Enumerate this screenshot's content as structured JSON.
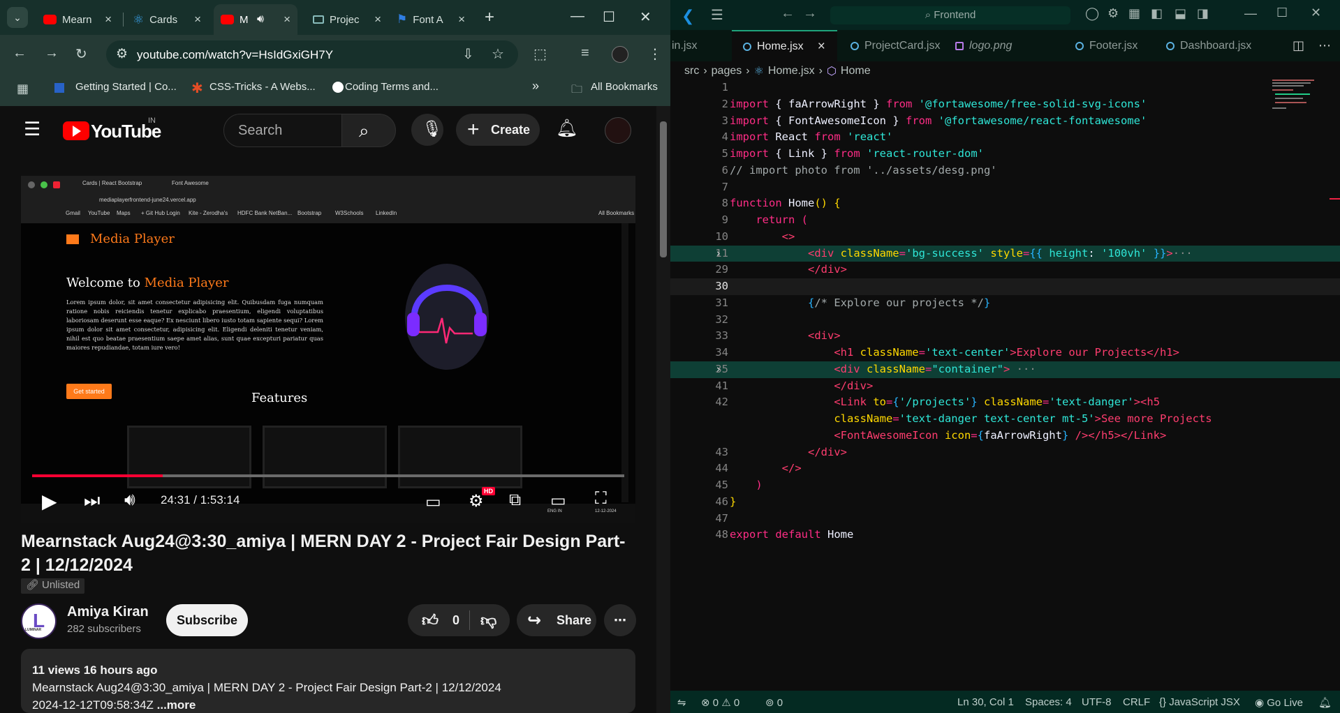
{
  "browser": {
    "tabs": [
      {
        "label": "Mearn",
        "icon": "youtube-icon"
      },
      {
        "label": "Cards",
        "icon": "react-bootstrap-icon"
      },
      {
        "label": "M",
        "icon": "youtube-icon"
      },
      {
        "label": "Projec",
        "icon": "vercel-icon"
      },
      {
        "label": "Font A",
        "icon": "flag-icon"
      }
    ],
    "new_tab": "+",
    "url": "youtube.com/watch?v=HsIdGxiGH7Y",
    "bookmarks": [
      "Getting Started | Co...",
      "CSS-Tricks - A Webs...",
      "Coding Terms and..."
    ],
    "all_bookmarks": "All Bookmarks",
    "more_bookmarks": "»"
  },
  "youtube": {
    "logo": "YouTube",
    "region": "IN",
    "search_placeholder": "Search",
    "create": "Create",
    "video": {
      "time": "24:31 / 1:53:14",
      "progress_percent": 22,
      "hd": "HD",
      "inner": {
        "tabs": [
          "Cards | React Bootstrap",
          "Font Awesome"
        ],
        "url": "mediaplayerfrontend-june24.vercel.app",
        "bookmarks": [
          "Gmail",
          "YouTube",
          "Maps",
          "+ Git Hub Login",
          "Kite - Zerodha's",
          "HDFC Bank NetBan...",
          "Bootstrap",
          "W3Schools",
          "LinkedIn"
        ],
        "all_bookmarks": "All Bookmarks",
        "app_title": "Media Player",
        "welcome": "Welcome to ",
        "welcome_highlight": "Media Player",
        "lorem": "Lorem ipsum dolor, sit amet consectetur adipisicing elit. Quibusdam fuga numquam ratione nobis reiciendis tenetur explicabo praesentium, eligendi voluptatibus laboriosam deserunt esse eaque? Ex nesciunt libero iusto totam sapiente sequi? Lorem ipsum dolor sit amet consectetur, adipisicing elit. Eligendi deleniti tenetur veniam, nihil est quo beatae praesentium saepe amet alias, sunt quae excepturi pariatur quas maiores repudiandae, totam iure vero!",
        "cta": "Get started",
        "features": "Features",
        "taskbar_lang": "ENG IN",
        "taskbar_date": "12-12-2024"
      }
    },
    "title": "Mearnstack Aug24@3:30_amiya | MERN DAY 2 - Project Fair Design Part-2 | 12/12/2024",
    "unlisted": "Unlisted",
    "channel": {
      "avatar": "L",
      "name": "Amiya Kiran",
      "subscribers": "282 subscribers",
      "avatar_label": "LUMINAR"
    },
    "subscribe": "Subscribe",
    "likes": "0",
    "share": "Share",
    "description": {
      "meta": "11 views  16 hours ago",
      "line1": "Mearnstack Aug24@3:30_amiya | MERN DAY 2 - Project Fair Design Part-2 | 12/12/2024",
      "line2": "2024-12-12T09:58:34Z",
      "more": " ...more"
    }
  },
  "vscode": {
    "command": "Frontend",
    "tabs": [
      "in.jsx",
      "Home.jsx",
      "ProjectCard.jsx",
      "logo.png",
      "Footer.jsx",
      "Dashboard.jsx"
    ],
    "active_tab": "Home.jsx",
    "breadcrumb": [
      "src",
      "pages",
      "Home.jsx",
      "Home"
    ],
    "lines": [
      {
        "n": "1",
        "html": ""
      },
      {
        "n": "2",
        "html": "<span class='kw'>import</span> <span class='id'>{ faArrowRight }</span> <span class='kw'>from</span> <span class='str'>'@fortawesome/free-solid-svg-icons'</span>"
      },
      {
        "n": "3",
        "html": "<span class='kw'>import</span> <span class='id'>{ FontAwesomeIcon }</span> <span class='kw'>from</span> <span class='str'>'@fortawesome/react-fontawesome'</span>"
      },
      {
        "n": "4",
        "html": "<span class='kw'>import</span> <span class='id'>React</span> <span class='kw'>from</span> <span class='str'>'react'</span>"
      },
      {
        "n": "5",
        "html": "<span class='kw'>import</span> <span class='id'>{ Link }</span> <span class='kw'>from</span> <span class='str'>'react-router-dom'</span>"
      },
      {
        "n": "6",
        "html": "<span class='cm'>// import photo from '../assets/desg.png'</span>"
      },
      {
        "n": "7",
        "html": ""
      },
      {
        "n": "8",
        "html": "<span class='kw'>function</span> <span class='id'>Home</span><span class='attr'>()</span> <span class='attr'>{</span>"
      },
      {
        "n": "9",
        "html": "    <span class='kw'>return</span> <span class='kw'>(</span>"
      },
      {
        "n": "10",
        "html": "        <span class='tag'>&lt;&gt;</span>"
      },
      {
        "n": "11",
        "html": "            <span class='tag'>&lt;div</span> <span class='attr'>className</span><span class='kw'>=</span><span class='str'>'bg-success'</span> <span class='attr'>style</span><span class='kw'>=</span><span class='brace'>{{</span> <span class='str'>height</span><span class='id'>:</span> <span class='str'>'100vh'</span> <span class='brace'>}}</span><span class='tag'>&gt;</span><span class='fold-dots'>···</span>",
        "cls": "hl",
        "fold": true
      },
      {
        "n": "29",
        "html": "            <span class='tag'>&lt;/div&gt;</span>"
      },
      {
        "n": "30",
        "html": "",
        "cls": "cur"
      },
      {
        "n": "31",
        "html": "            <span class='brace'>{</span><span class='cm'>/* Explore our projects */</span><span class='brace'>}</span>"
      },
      {
        "n": "32",
        "html": ""
      },
      {
        "n": "33",
        "html": "            <span class='tag'>&lt;div&gt;</span>"
      },
      {
        "n": "34",
        "html": "                <span class='tag'>&lt;h1</span> <span class='attr'>className</span><span class='kw'>=</span><span class='str'>'text-center'</span><span class='tag'>&gt;Explore our Projects&lt;/h1&gt;</span>"
      },
      {
        "n": "35",
        "html": "                <span class='tag'>&lt;div</span> <span class='attr'>className</span><span class='kw'>=</span><span class='str'>\"container\"</span><span class='tag'>&gt;</span> <span class='fold-dots'>···</span>",
        "cls": "hl",
        "fold": true
      },
      {
        "n": "41",
        "html": "                <span class='tag'>&lt;/div&gt;</span>"
      },
      {
        "n": "42",
        "html": "                <span class='tag'>&lt;Link</span> <span class='attr'>to</span><span class='kw'>=</span><span class='brace'>{</span><span class='str'>'/projects'</span><span class='brace'>}</span> <span class='attr'>className</span><span class='kw'>=</span><span class='str'>'text-danger'</span><span class='tag'>&gt;&lt;h5</span>"
      },
      {
        "n": "",
        "html": "                <span class='attr'>className</span><span class='kw'>=</span><span class='str'>'text-danger text-center mt-5'</span><span class='tag'>&gt;See more Projects</span>"
      },
      {
        "n": "",
        "html": "                <span class='tag'>&lt;FontAwesomeIcon</span> <span class='attr'>icon</span><span class='kw'>=</span><span class='brace'>{</span><span class='id'>faArrowRight</span><span class='brace'>}</span> <span class='tag'>/&gt;&lt;/h5&gt;&lt;/Link&gt;</span>"
      },
      {
        "n": "43",
        "html": "            <span class='tag'>&lt;/div&gt;</span>"
      },
      {
        "n": "44",
        "html": "        <span class='tag'>&lt;/&gt;</span>"
      },
      {
        "n": "45",
        "html": "    <span class='kw'>)</span>"
      },
      {
        "n": "46",
        "html": "<span class='attr'>}</span>"
      },
      {
        "n": "47",
        "html": ""
      },
      {
        "n": "48",
        "html": "<span class='kw'>export</span> <span class='kw'>default</span> <span class='id'>Home</span>"
      }
    ],
    "status": {
      "errors": "0",
      "warnings": "0",
      "ports": "0",
      "position": "Ln 30, Col 1",
      "spaces": "Spaces: 4",
      "encoding": "UTF-8",
      "eol": "CRLF",
      "language": "JavaScript JSX",
      "live": "Go Live"
    }
  },
  "colors": {
    "accent": "#ff0033",
    "vscode_highlight": "#0e3f35",
    "browser_frame": "#253a35"
  }
}
